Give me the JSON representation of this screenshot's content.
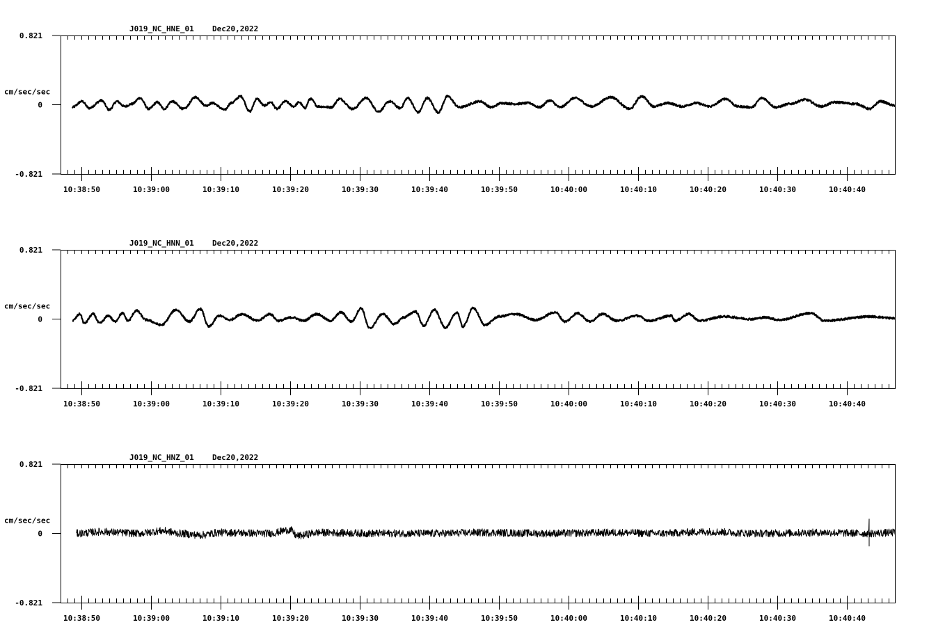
{
  "chart_data": [
    {
      "type": "line",
      "title": "J019_NC_HNE_01",
      "date": "Dec20,2022",
      "ylabel": "cm/sec/sec",
      "ytick_labels": [
        "0.821",
        "0",
        "-0.821"
      ],
      "ylim": [
        -0.821,
        0.821
      ],
      "x_start": "10:38:47",
      "x_range_seconds": [
        0,
        120
      ],
      "xtick_labels": [
        "10:38:50",
        "10:39:00",
        "10:39:10",
        "10:39:20",
        "10:39:30",
        "10:39:40",
        "10:39:50",
        "10:40:00",
        "10:40:10",
        "10:40:20",
        "10:40:30",
        "10:40:40"
      ],
      "noise_amplitude": 0.012,
      "points_t_v": [
        [
          1.7,
          -0.03
        ],
        [
          3.1,
          0.04
        ],
        [
          4.1,
          -0.04
        ],
        [
          5.9,
          0.05
        ],
        [
          7.0,
          -0.06
        ],
        [
          8.1,
          0.04
        ],
        [
          9.2,
          -0.02
        ],
        [
          10.3,
          0.01
        ],
        [
          11.4,
          0.08
        ],
        [
          12.7,
          -0.05
        ],
        [
          13.9,
          0.03
        ],
        [
          14.9,
          -0.05
        ],
        [
          16.0,
          0.04
        ],
        [
          17.7,
          -0.05
        ],
        [
          19.4,
          0.09
        ],
        [
          20.9,
          -0.01
        ],
        [
          21.8,
          0.02
        ],
        [
          23.6,
          -0.06
        ],
        [
          24.5,
          0.02
        ],
        [
          25.9,
          0.1
        ],
        [
          27.2,
          -0.08
        ],
        [
          28.2,
          0.07
        ],
        [
          29.3,
          -0.01
        ],
        [
          30.2,
          0.03
        ],
        [
          31.1,
          -0.05
        ],
        [
          32.3,
          0.04
        ],
        [
          33.5,
          -0.02
        ],
        [
          34.3,
          0.03
        ],
        [
          35.1,
          -0.04
        ],
        [
          35.9,
          0.07
        ],
        [
          37.0,
          -0.02
        ],
        [
          38.9,
          -0.03
        ],
        [
          40.1,
          0.07
        ],
        [
          42.0,
          -0.05
        ],
        [
          43.9,
          0.08
        ],
        [
          45.7,
          -0.08
        ],
        [
          47.3,
          0.04
        ],
        [
          48.8,
          -0.04
        ],
        [
          49.9,
          0.08
        ],
        [
          51.4,
          -0.09
        ],
        [
          52.7,
          0.08
        ],
        [
          54.3,
          -0.09
        ],
        [
          55.6,
          0.1
        ],
        [
          57.3,
          -0.03
        ],
        [
          60.3,
          0.04
        ],
        [
          61.9,
          -0.03
        ],
        [
          63.4,
          0.02
        ],
        [
          65.3,
          0.01
        ],
        [
          67.3,
          0.02
        ],
        [
          68.8,
          -0.03
        ],
        [
          70.3,
          0.05
        ],
        [
          71.8,
          -0.03
        ],
        [
          73.9,
          0.08
        ],
        [
          76.3,
          -0.02
        ],
        [
          79.1,
          0.09
        ],
        [
          81.8,
          -0.05
        ],
        [
          83.5,
          0.1
        ],
        [
          85.3,
          -0.02
        ],
        [
          87.3,
          0.02
        ],
        [
          89.3,
          -0.02
        ],
        [
          91.3,
          0.02
        ],
        [
          93.3,
          -0.02
        ],
        [
          95.6,
          0.07
        ],
        [
          97.3,
          -0.02
        ],
        [
          99.3,
          -0.03
        ],
        [
          100.8,
          0.08
        ],
        [
          102.8,
          -0.03
        ],
        [
          104.8,
          0.01
        ],
        [
          107.0,
          0.06
        ],
        [
          109.3,
          -0.02
        ],
        [
          111.3,
          0.03
        ],
        [
          114.3,
          0.01
        ],
        [
          116.3,
          -0.05
        ],
        [
          117.8,
          0.04
        ],
        [
          119.9,
          -0.01
        ]
      ]
    },
    {
      "type": "line",
      "title": "J019_NC_HNN_01",
      "date": "Dec20,2022",
      "ylabel": "cm/sec/sec",
      "ytick_labels": [
        "0.821",
        "0",
        "-0.821"
      ],
      "ylim": [
        -0.821,
        0.821
      ],
      "x_start": "10:38:47",
      "x_range_seconds": [
        0,
        120
      ],
      "xtick_labels": [
        "10:38:50",
        "10:39:00",
        "10:39:10",
        "10:39:20",
        "10:39:30",
        "10:39:40",
        "10:39:50",
        "10:40:00",
        "10:40:10",
        "10:40:20",
        "10:40:30",
        "10:40:40"
      ],
      "noise_amplitude": 0.012,
      "points_t_v": [
        [
          1.7,
          -0.02
        ],
        [
          2.8,
          0.06
        ],
        [
          3.4,
          -0.05
        ],
        [
          4.7,
          0.06
        ],
        [
          5.6,
          -0.05
        ],
        [
          6.9,
          0.04
        ],
        [
          7.8,
          -0.03
        ],
        [
          8.9,
          0.07
        ],
        [
          9.7,
          -0.02
        ],
        [
          10.9,
          0.1
        ],
        [
          12.3,
          -0.01
        ],
        [
          14.5,
          -0.07
        ],
        [
          16.6,
          0.11
        ],
        [
          18.5,
          -0.03
        ],
        [
          20.1,
          0.12
        ],
        [
          21.3,
          -0.09
        ],
        [
          22.8,
          0.04
        ],
        [
          24.3,
          -0.01
        ],
        [
          26.1,
          0.06
        ],
        [
          28.3,
          -0.02
        ],
        [
          30.1,
          0.06
        ],
        [
          31.3,
          -0.02
        ],
        [
          33.3,
          0.02
        ],
        [
          34.9,
          -0.02
        ],
        [
          36.8,
          0.06
        ],
        [
          38.8,
          -0.02
        ],
        [
          40.3,
          0.08
        ],
        [
          41.8,
          -0.03
        ],
        [
          43.2,
          0.13
        ],
        [
          44.4,
          -0.11
        ],
        [
          46.3,
          0.06
        ],
        [
          48.0,
          -0.06
        ],
        [
          49.3,
          0.02
        ],
        [
          51.0,
          0.09
        ],
        [
          52.2,
          -0.08
        ],
        [
          53.7,
          0.11
        ],
        [
          55.3,
          -0.1
        ],
        [
          57.0,
          0.08
        ],
        [
          57.8,
          -0.09
        ],
        [
          59.3,
          0.13
        ],
        [
          61.0,
          -0.07
        ],
        [
          63.0,
          0.03
        ],
        [
          65.3,
          0.06
        ],
        [
          68.3,
          -0.01
        ],
        [
          71.1,
          0.08
        ],
        [
          72.5,
          -0.03
        ],
        [
          74.3,
          0.07
        ],
        [
          76.1,
          -0.03
        ],
        [
          77.8,
          0.06
        ],
        [
          80.0,
          -0.02
        ],
        [
          82.8,
          0.04
        ],
        [
          84.6,
          -0.02
        ],
        [
          87.8,
          0.04
        ],
        [
          88.3,
          -0.02
        ],
        [
          90.3,
          0.06
        ],
        [
          91.8,
          -0.02
        ],
        [
          95.3,
          0.03
        ],
        [
          99.3,
          0.0
        ],
        [
          101.3,
          0.02
        ],
        [
          103.3,
          -0.01
        ],
        [
          107.8,
          0.07
        ],
        [
          109.8,
          -0.02
        ],
        [
          116.3,
          0.03
        ],
        [
          119.9,
          0.01
        ]
      ]
    },
    {
      "type": "line",
      "title": "J019_NC_HNZ_01",
      "date": "Dec20,2022",
      "ylabel": "cm/sec/sec",
      "ytick_labels": [
        "0.821",
        "0",
        "-0.821"
      ],
      "ylim": [
        -0.821,
        0.821
      ],
      "x_start": "10:38:47",
      "x_range_seconds": [
        0,
        120
      ],
      "xtick_labels": [
        "10:38:50",
        "10:39:00",
        "10:39:10",
        "10:39:20",
        "10:39:30",
        "10:39:40",
        "10:39:50",
        "10:40:00",
        "10:40:10",
        "10:40:20",
        "10:40:30",
        "10:40:40"
      ],
      "noise_amplitude": 0.045,
      "points_t_v": [
        [
          2.3,
          0.0
        ],
        [
          6.0,
          0.02
        ],
        [
          8.5,
          0.01
        ],
        [
          11.0,
          0.0
        ],
        [
          14.8,
          0.03
        ],
        [
          17.0,
          0.0
        ],
        [
          20.0,
          -0.02
        ],
        [
          23.0,
          0.01
        ],
        [
          30.0,
          0.0
        ],
        [
          33.0,
          0.04
        ],
        [
          34.0,
          -0.03
        ],
        [
          37.0,
          0.01
        ],
        [
          45.0,
          0.0
        ],
        [
          55.0,
          0.0
        ],
        [
          60.0,
          0.01
        ],
        [
          70.0,
          0.0
        ],
        [
          80.0,
          0.01
        ],
        [
          86.0,
          0.0
        ],
        [
          93.0,
          0.02
        ],
        [
          100.0,
          0.0
        ],
        [
          110.0,
          0.01
        ],
        [
          115.5,
          0.0
        ],
        [
          116.2,
          0.0
        ],
        [
          119.9,
          0.01
        ]
      ],
      "spike": {
        "t": 116.2,
        "max": 0.17,
        "min": -0.15
      }
    }
  ]
}
